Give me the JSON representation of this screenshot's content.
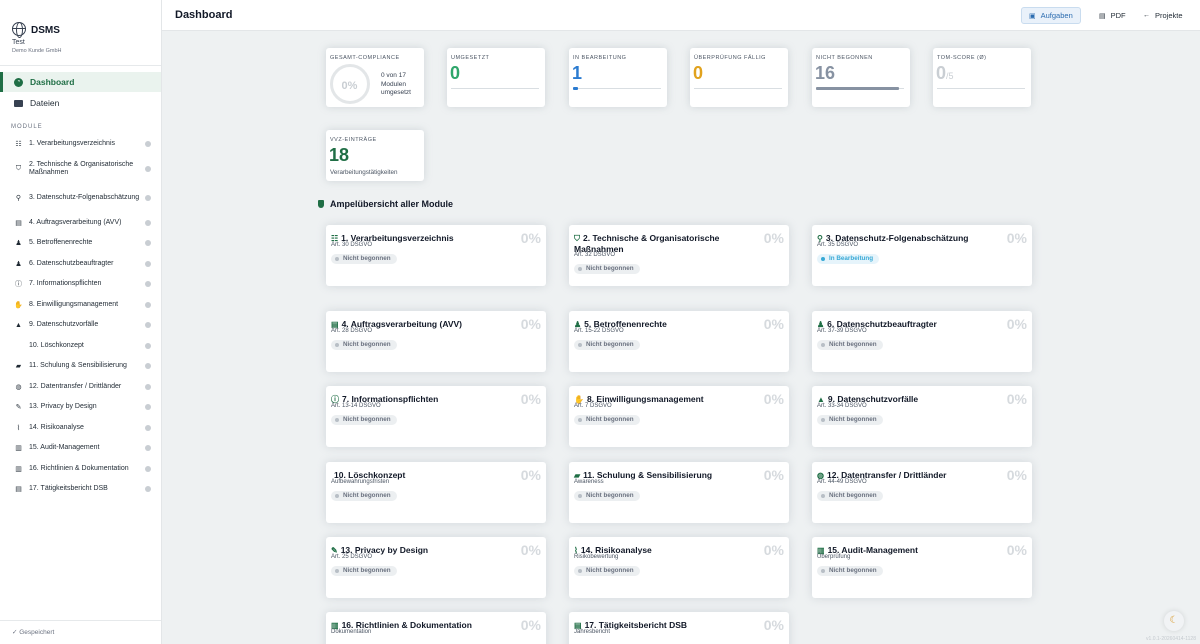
{
  "brand": {
    "title": "DSMS",
    "client": "Test",
    "subtitle": "Demo Kunde GmbH"
  },
  "nav": {
    "dashboard": "Dashboard",
    "files": "Dateien"
  },
  "modules_heading": "MODULE",
  "sidebar_modules": [
    {
      "label": "1. Verarbeitungsverzeichnis",
      "icon": "list-icon"
    },
    {
      "label": "2. Technische & Organisatorische Maßnahmen",
      "icon": "shield-icon"
    },
    {
      "label": "3. Datenschutz-Folgenabschätzung",
      "icon": "search-icon"
    },
    {
      "label": "4. Auftragsverarbeitung (AVV)",
      "icon": "document-icon"
    },
    {
      "label": "5. Betroffenenrechte",
      "icon": "user-check-icon"
    },
    {
      "label": "6. Datenschutzbeauftragter",
      "icon": "user-icon"
    },
    {
      "label": "7. Informationspflichten",
      "icon": "info-icon"
    },
    {
      "label": "8. Einwilligungsmanagement",
      "icon": "hand-icon"
    },
    {
      "label": "9. Datenschutzvorfälle",
      "icon": "warning-icon"
    },
    {
      "label": "10. Löschkonzept",
      "icon": "trash-icon"
    },
    {
      "label": "11. Schulung & Sensibilisierung",
      "icon": "graduation-icon"
    },
    {
      "label": "12. Datentransfer / Drittländer",
      "icon": "globe-icon"
    },
    {
      "label": "13. Privacy by Design",
      "icon": "wand-icon"
    },
    {
      "label": "14. Risikoanalyse",
      "icon": "chart-line-icon"
    },
    {
      "label": "15. Audit-Management",
      "icon": "book-icon"
    },
    {
      "label": "16. Richtlinien & Dokumentation",
      "icon": "book-icon"
    },
    {
      "label": "17. Tätigkeitsbericht DSB",
      "icon": "report-icon"
    }
  ],
  "saved": "✓ Gespeichert",
  "header": {
    "title": "Dashboard",
    "tasks": "Aufgaben",
    "pdf": "PDF",
    "projects": "Projekte"
  },
  "kpis": {
    "compliance": {
      "label": "GESAMT-COMPLIANCE",
      "value": "0%",
      "text": "0 von 17 Modulen umgesetzt"
    },
    "done": {
      "label": "UMGESETZT",
      "value": "0",
      "color": "#2fa66b"
    },
    "in_progress": {
      "label": "IN BEARBEITUNG",
      "value": "1",
      "color": "#2b7bd0",
      "fraction": 0.06
    },
    "review": {
      "label": "ÜBERPRÜFUNG FÄLLIG",
      "value": "0",
      "color": "#e1a21d"
    },
    "not_started": {
      "label": "NICHT BEGONNEN",
      "value": "16",
      "color": "#8792a2",
      "fraction": 0.94
    },
    "tom": {
      "label": "TOM-SCORE (Ø)",
      "value": "0",
      "max": "/5",
      "color": "#c9ced3"
    },
    "vvz": {
      "label": "VVZ-EINTRÄGE",
      "value": "18",
      "sub": "Verarbeitungstätigkeiten",
      "color": "#1f6e45"
    }
  },
  "section_title": "Ampelübersicht aller Module",
  "cards": [
    {
      "title": "1. Verarbeitungsverzeichnis",
      "sub": "Art. 30 DSGVO",
      "pct": "0%",
      "status": "Nicht begonnen",
      "icon": "list-icon"
    },
    {
      "title": "2. Technische & Organisatorische Maßnahmen",
      "sub": "Art. 32 DSGVO",
      "pct": "0%",
      "status": "Nicht begonnen",
      "icon": "shield-icon"
    },
    {
      "title": "3. Datenschutz-Folgenabschätzung",
      "sub": "Art. 35 DSGVO",
      "pct": "0%",
      "status": "In Bearbeitung",
      "icon": "search-icon"
    },
    {
      "title": "4. Auftragsverarbeitung (AVV)",
      "sub": "Art. 28 DSGVO",
      "pct": "0%",
      "status": "Nicht begonnen",
      "icon": "document-icon"
    },
    {
      "title": "5. Betroffenenrechte",
      "sub": "Art. 15-22 DSGVO",
      "pct": "0%",
      "status": "Nicht begonnen",
      "icon": "user-check-icon"
    },
    {
      "title": "6. Datenschutzbeauftragter",
      "sub": "Art. 37-39 DSGVO",
      "pct": "0%",
      "status": "Nicht begonnen",
      "icon": "user-icon"
    },
    {
      "title": "7. Informationspflichten",
      "sub": "Art. 13-14 DSGVO",
      "pct": "0%",
      "status": "Nicht begonnen",
      "icon": "info-icon"
    },
    {
      "title": "8. Einwilligungsmanagement",
      "sub": "Art. 7 DSGVO",
      "pct": "0%",
      "status": "Nicht begonnen",
      "icon": "hand-icon"
    },
    {
      "title": "9. Datenschutzvorfälle",
      "sub": "Art. 33-34 DSGVO",
      "pct": "0%",
      "status": "Nicht begonnen",
      "icon": "warning-icon"
    },
    {
      "title": "10. Löschkonzept",
      "sub": "Aufbewahrungsfristen",
      "pct": "0%",
      "status": "Nicht begonnen",
      "icon": "trash-icon"
    },
    {
      "title": "11. Schulung & Sensibilisierung",
      "sub": "Awareness",
      "pct": "0%",
      "status": "Nicht begonnen",
      "icon": "graduation-icon"
    },
    {
      "title": "12. Datentransfer / Drittländer",
      "sub": "Art. 44-49 DSGVO",
      "pct": "0%",
      "status": "Nicht begonnen",
      "icon": "globe-icon"
    },
    {
      "title": "13. Privacy by Design",
      "sub": "Art. 25 DSGVO",
      "pct": "0%",
      "status": "Nicht begonnen",
      "icon": "wand-icon"
    },
    {
      "title": "14. Risikoanalyse",
      "sub": "Risikobewertung",
      "pct": "0%",
      "status": "Nicht begonnen",
      "icon": "chart-line-icon"
    },
    {
      "title": "15. Audit-Management",
      "sub": "Überprüfung",
      "pct": "0%",
      "status": "Nicht begonnen",
      "icon": "book-icon"
    },
    {
      "title": "16. Richtlinien & Dokumentation",
      "sub": "Dokumentation",
      "pct": "0%",
      "status": "",
      "icon": "book-icon"
    },
    {
      "title": "17. Tätigkeitsbericht DSB",
      "sub": "Jahresbericht",
      "pct": "0%",
      "status": "",
      "icon": "report-icon"
    }
  ],
  "version": "v1.0.1-20260414-1128"
}
